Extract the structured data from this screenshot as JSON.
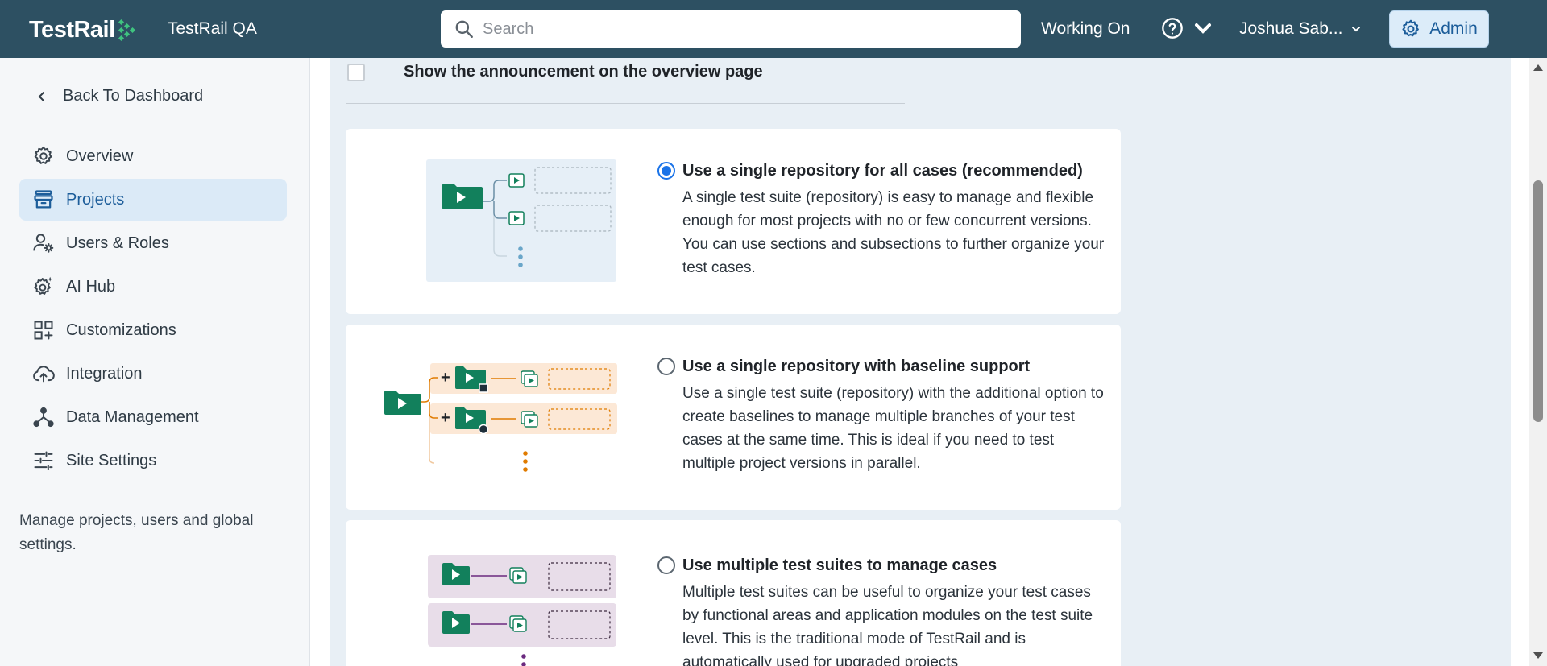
{
  "header": {
    "logo_text": "TestRail",
    "instance_name": "TestRail QA",
    "search_placeholder": "Search",
    "working_on": "Working On",
    "user_name": "Joshua Sab...",
    "admin_label": "Admin",
    "colors": {
      "header_bg": "#2d5062",
      "admin_bg": "#dcecf9",
      "accent": "#1c5d9a"
    }
  },
  "sidebar": {
    "back_label": "Back To Dashboard",
    "items": [
      {
        "label": "Overview",
        "icon": "gear-icon",
        "active": false
      },
      {
        "label": "Projects",
        "icon": "projects-icon",
        "active": true
      },
      {
        "label": "Users & Roles",
        "icon": "users-roles-icon",
        "active": false
      },
      {
        "label": "AI Hub",
        "icon": "ai-hub-icon",
        "active": false
      },
      {
        "label": "Customizations",
        "icon": "customizations-icon",
        "active": false
      },
      {
        "label": "Integration",
        "icon": "cloud-upload-icon",
        "active": false
      },
      {
        "label": "Data Management",
        "icon": "data-management-icon",
        "active": false
      },
      {
        "label": "Site Settings",
        "icon": "sliders-icon",
        "active": false
      }
    ],
    "note": "Manage projects, users and global settings."
  },
  "main": {
    "announcement": {
      "label": "Show the announcement on the overview page",
      "checked": false
    },
    "options": [
      {
        "title": "Use a single repository for all cases (recommended)",
        "description": "A single test suite (repository) is easy to manage and flexible enough for most projects with no or few concurrent versions. You can use sections and subsections to further organize your test cases.",
        "selected": true
      },
      {
        "title": "Use a single repository with baseline support",
        "description": "Use a single test suite (repository) with the additional option to create baselines to manage multiple branches of your test cases at the same time. This is ideal if you need to test multiple project versions in parallel.",
        "selected": false
      },
      {
        "title": "Use multiple test suites to manage cases",
        "description": "Multiple test suites can be useful to organize your test cases by functional areas and application modules on the test suite level. This is the traditional mode of TestRail and is automatically used for upgraded projects",
        "selected": false
      }
    ],
    "colors": {
      "green": "#12805c",
      "orange": "#e07b00",
      "purple": "#6b2a7f",
      "radio_selected": "#1a73e8"
    }
  }
}
